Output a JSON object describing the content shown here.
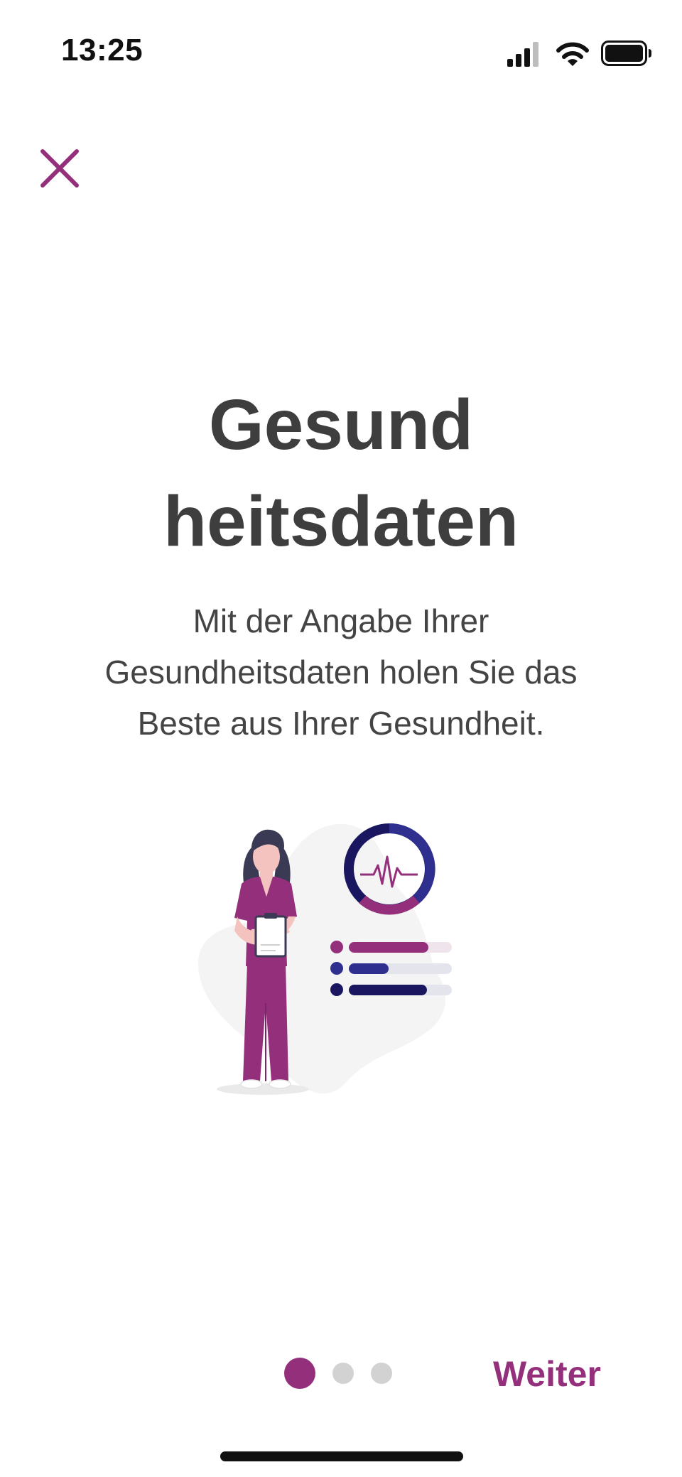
{
  "status_bar": {
    "time": "13:25",
    "icons": [
      "signal-icon",
      "wifi-icon",
      "battery-icon"
    ]
  },
  "header": {
    "close_icon": "close-icon"
  },
  "main": {
    "title_line1": "Gesund",
    "title_line2": "heitsdaten",
    "subtitle_line1": "Mit der Angabe Ihrer",
    "subtitle_line2": "Gesundheitsdaten holen Sie das",
    "subtitle_line3": "Beste aus Ihrer Gesundheit.",
    "illustration": "nurse-health-data-illustration"
  },
  "footer": {
    "pager": {
      "total": 3,
      "active_index": 0
    },
    "next_label": "Weiter"
  },
  "colors": {
    "accent": "#94307b",
    "navy": "#1a1760",
    "indigo": "#2e2f8f",
    "text": "#3e3e3e",
    "inactive_dot": "#d2d2d2"
  }
}
